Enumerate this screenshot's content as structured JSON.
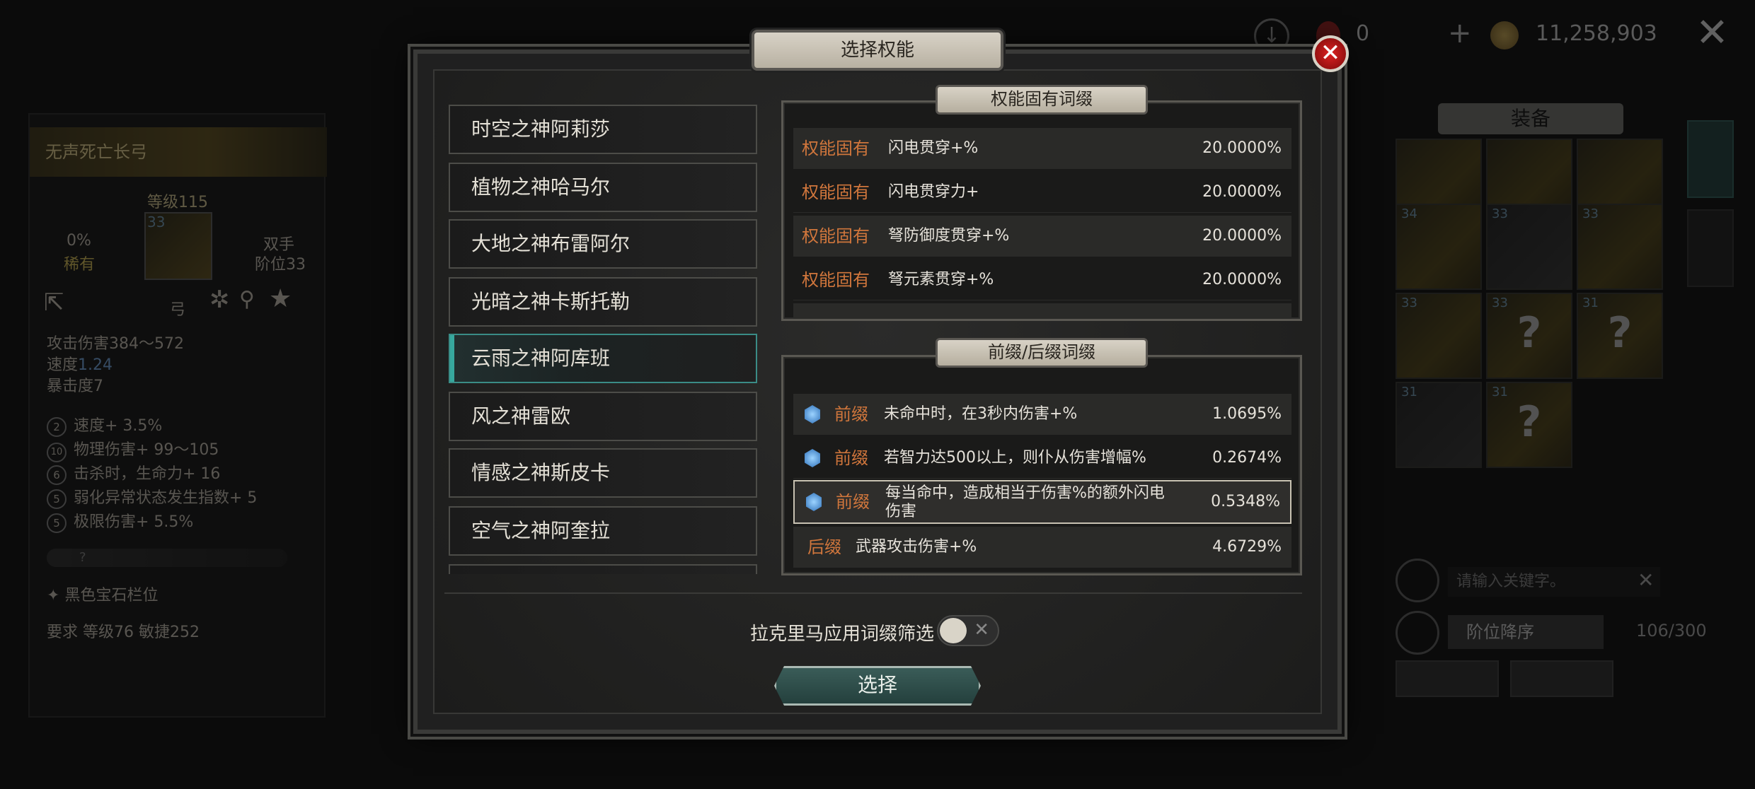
{
  "background": {
    "topbar": {
      "currency_a": "0",
      "currency_b": "11,258,903",
      "plus": "+",
      "close": "✕"
    },
    "item_panel": {
      "name": "无声死亡长弓",
      "level": "等级115",
      "item_level": "33",
      "rarity_pct": "0%",
      "rarity": "稀有",
      "hand": "双手",
      "tier": "阶位33",
      "type": "弓",
      "attack": "攻击伤害384～572",
      "speed_label": "速度",
      "speed_value": "1.24",
      "crit": "暴击度7",
      "bonuses": [
        "速度+ 3.5%",
        "物理伤害+ 99～105",
        "击杀时，生命力+ 16",
        "弱化异常状态发生指数+ 5",
        "极限伤害+ 5.5%"
      ],
      "bonus_tiers": [
        "2",
        "10",
        "6",
        "5",
        "5"
      ],
      "unknown_tier": "?",
      "gem_slot": "黑色宝石栏位",
      "requirement": "要求 等级76  敏捷252"
    },
    "equipment": {
      "title": "装备",
      "slots": [
        {
          "num": "",
          "q": ""
        },
        {
          "num": "",
          "q": ""
        },
        {
          "num": "",
          "q": ""
        },
        {
          "num": "34",
          "q": ""
        },
        {
          "num": "33",
          "q": ""
        },
        {
          "num": "33",
          "q": ""
        },
        {
          "num": "33",
          "q": ""
        },
        {
          "num": "33",
          "q": "?"
        },
        {
          "num": "31",
          "q": "?"
        },
        {
          "num": "31",
          "q": ""
        },
        {
          "num": "31",
          "q": "?"
        }
      ],
      "search_placeholder": "请输入关键字。",
      "sort": "阶位降序",
      "capacity": "106/300"
    }
  },
  "modal": {
    "title": "选择权能",
    "gods": [
      "时空之神阿莉莎",
      "植物之神哈马尔",
      "大地之神布雷阿尔",
      "光暗之神卡斯托勒",
      "云雨之神阿库班",
      "风之神雷欧",
      "情感之神斯皮卡",
      "空气之神阿奎拉"
    ],
    "selected_god_index": 4,
    "inherent": {
      "title": "权能固有词缀",
      "rows": [
        {
          "tag": "权能固有",
          "desc": "闪电贯穿+%",
          "val": "20.0000%"
        },
        {
          "tag": "权能固有",
          "desc": "闪电贯穿力+",
          "val": "20.0000%"
        },
        {
          "tag": "权能固有",
          "desc": "弩防御度贯穿+%",
          "val": "20.0000%"
        },
        {
          "tag": "权能固有",
          "desc": "弩元素贯穿+%",
          "val": "20.0000%"
        }
      ]
    },
    "affix": {
      "title": "前缀/后缀词缀",
      "rows": [
        {
          "tag": "前缀",
          "desc": "未命中时，在3秒内伤害+%",
          "val": "1.0695%"
        },
        {
          "tag": "前缀",
          "desc": "若智力达500以上，则仆从伤害增幅%",
          "val": "0.2674%"
        },
        {
          "tag": "前缀",
          "desc": "每当命中，造成相当于伤害%的额外闪电",
          "desc2": "伤害",
          "val": "0.5348%"
        },
        {
          "tag": "后缀",
          "desc": "武器攻击伤害+%",
          "val": "4.6729%"
        }
      ]
    },
    "filter_label": "拉克里马应用词缀筛选",
    "toggle_off": "✕",
    "select_button": "选择",
    "close": "✕"
  }
}
